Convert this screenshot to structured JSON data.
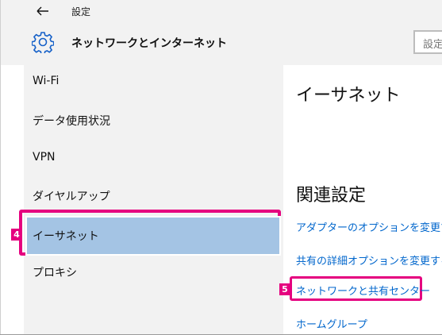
{
  "window": {
    "title": "設定"
  },
  "header": {
    "app_title": "ネットワークとインターネット",
    "search_text": "設定"
  },
  "sidebar": {
    "items": [
      {
        "label": "Wi-Fi"
      },
      {
        "label": "データ使用状況"
      },
      {
        "label": "VPN"
      },
      {
        "label": "ダイヤルアップ"
      },
      {
        "label": "イーサネット",
        "selected": true
      },
      {
        "label": "プロキシ"
      }
    ]
  },
  "main": {
    "title": "イーサネット",
    "related_title": "関連設定",
    "links": [
      {
        "label": "アダプターのオプションを変更する"
      },
      {
        "label": "共有の詳細オプションを変更する"
      },
      {
        "label": "ネットワークと共有センター"
      },
      {
        "label": "ホームグループ"
      }
    ]
  },
  "annotations": {
    "step4": "4",
    "step5": "5"
  },
  "colors": {
    "accent": "#e5007f",
    "link": "#0066cc",
    "selection": "#a4c4e4",
    "panel": "#f2f2f2"
  }
}
